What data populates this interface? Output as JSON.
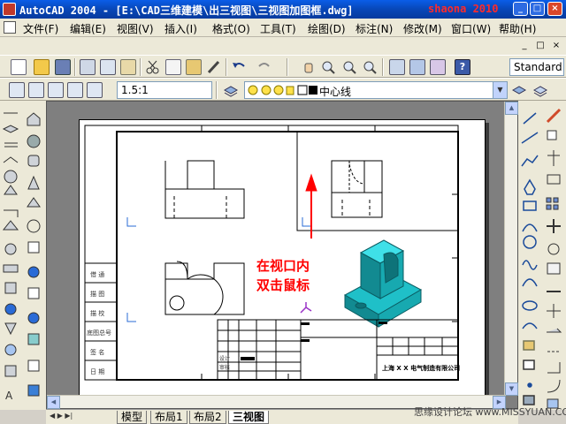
{
  "window": {
    "title": "AutoCAD 2004 - [E:\\CAD三维建模\\出三视图\\三视图加图框.dwg]",
    "watermark": "shaona 2010",
    "buttons": [
      "_",
      "□",
      "×"
    ]
  },
  "menu": {
    "items": [
      "文件(F)",
      "编辑(E)",
      "视图(V)",
      "插入(I)",
      "格式(O)",
      "工具(T)",
      "绘图(D)",
      "标注(N)",
      "修改(M)",
      "窗口(W)",
      "帮助(H)"
    ],
    "doc_controls": [
      "_",
      "□",
      "×"
    ]
  },
  "toolbar": {
    "text_style": "Standard",
    "scale": "1.5:1",
    "linetype": "中心线"
  },
  "drawing": {
    "annotation_line1": "在视口内",
    "annotation_line2": "双击鼠标",
    "company": "上海 X X 电气制造有限公司",
    "title_block_labels": [
      "设计",
      "审核"
    ],
    "side_labels": [
      "借 通",
      "描 图",
      "描 校",
      "底图总号",
      "签 名",
      "日 期"
    ],
    "coord_labels": [
      "Y",
      "X",
      "Y",
      "X"
    ]
  },
  "tabs": [
    "模型",
    "布局1",
    "布局2",
    "三视图"
  ],
  "footer": {
    "site": "思缘设计论坛 www.MISSYUAN.COM"
  },
  "colors": {
    "titlebar": "#0a5de8",
    "watermark": "#ff2a2a",
    "annotation": "#ff0000",
    "model": "#1fc0c8"
  }
}
